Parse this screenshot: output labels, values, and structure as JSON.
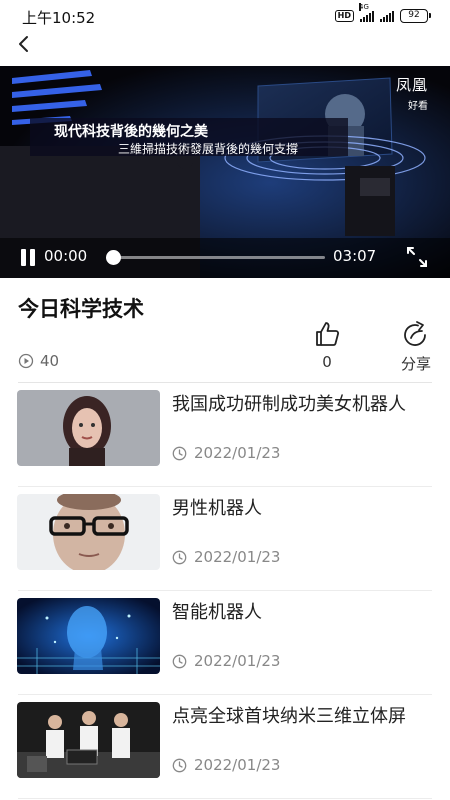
{
  "status_bar": {
    "time": "上午10:52",
    "hd": "HD",
    "network": "4G",
    "battery": "92"
  },
  "video": {
    "brand": "凤凰",
    "brand_sub": "好看",
    "subtitle_line1": "现代科技背後的幾何之美",
    "subtitle_line2": "三維掃描技術發展背後的幾何支撐",
    "current_time": "00:00",
    "total_time": "03:07",
    "progress": 0
  },
  "info": {
    "title": "今日科学技术",
    "views": "40",
    "likes": "0",
    "share_label": "分享"
  },
  "list": [
    {
      "title": "我国成功研制成功美女机器人",
      "date": "2022/01/23"
    },
    {
      "title": "男性机器人",
      "date": "2022/01/23"
    },
    {
      "title": "智能机器人",
      "date": "2022/01/23"
    },
    {
      "title": "点亮全球首块纳米三维立体屏",
      "date": "2022/01/23"
    }
  ],
  "colors": {
    "background": "#ffffff",
    "title_text": "#111111",
    "meta_text": "#888888",
    "video_bg": "#05050a"
  }
}
